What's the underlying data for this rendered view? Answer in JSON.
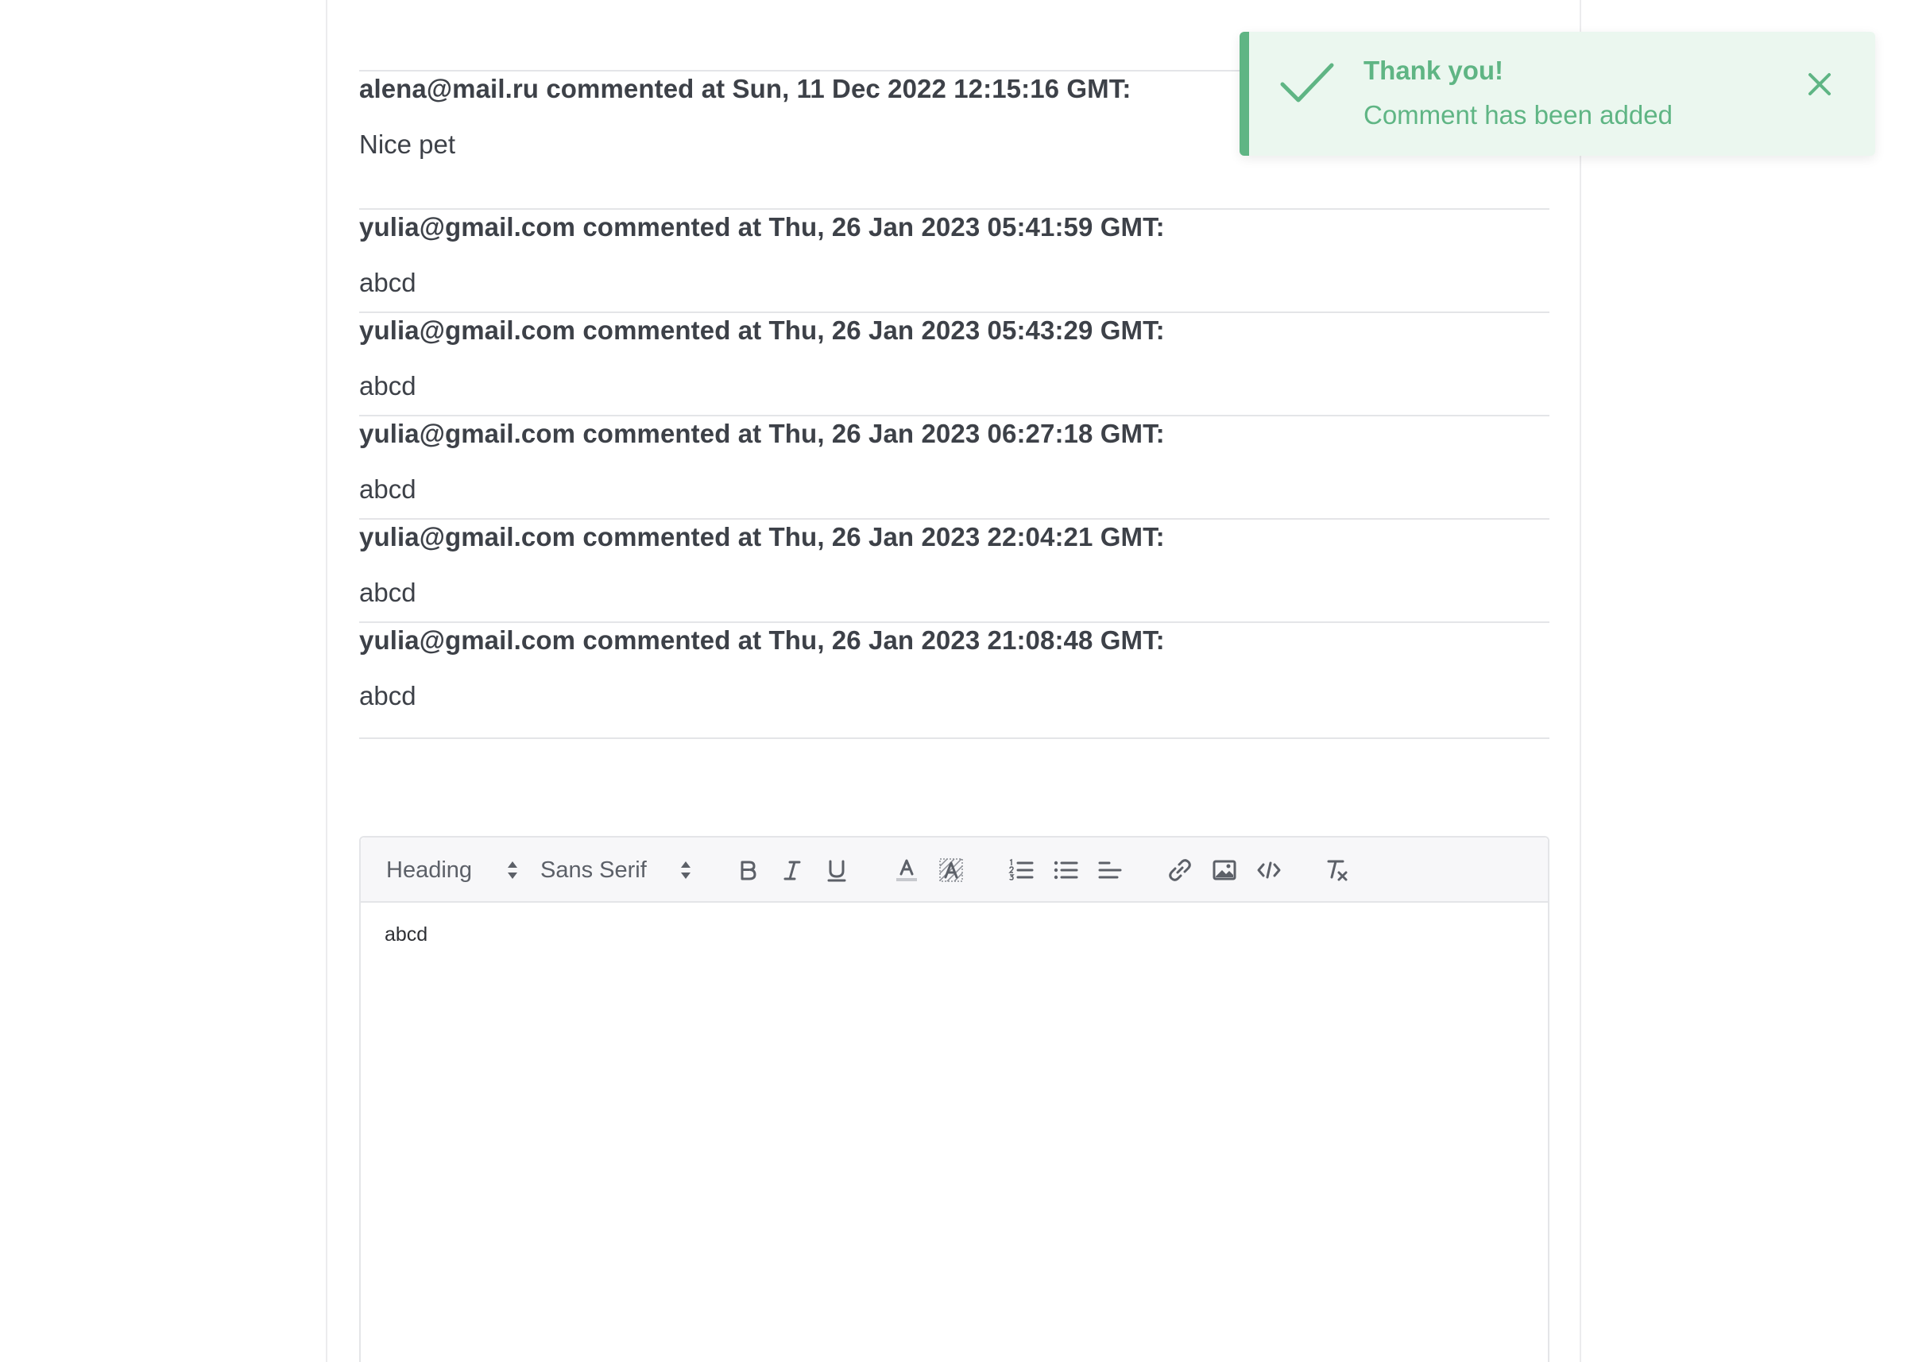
{
  "comments": [
    {
      "header": "alena@mail.ru commented at Sun, 11 Dec 2022 12:15:16 GMT:",
      "body": "Nice pet"
    },
    {
      "header": "yulia@gmail.com commented at Thu, 26 Jan 2023 05:41:59 GMT:",
      "body": "abcd"
    },
    {
      "header": "yulia@gmail.com commented at Thu, 26 Jan 2023 05:43:29 GMT:",
      "body": "abcd"
    },
    {
      "header": "yulia@gmail.com commented at Thu, 26 Jan 2023 06:27:18 GMT:",
      "body": "abcd"
    },
    {
      "header": "yulia@gmail.com commented at Thu, 26 Jan 2023 22:04:21 GMT:",
      "body": "abcd"
    },
    {
      "header": "yulia@gmail.com commented at Thu, 26 Jan 2023 21:08:48 GMT:",
      "body": "abcd"
    }
  ],
  "editor": {
    "heading_picker": "Heading",
    "font_picker": "Sans Serif",
    "content": "abcd",
    "tools": [
      "bold-icon",
      "italic-icon",
      "underline-icon",
      "text-color-icon",
      "background-color-icon",
      "ordered-list-icon",
      "bullet-list-icon",
      "align-icon",
      "link-icon",
      "image-icon",
      "code-icon",
      "clear-format-icon"
    ]
  },
  "toast": {
    "title": "Thank you!",
    "message": "Comment has been added",
    "accent": "#5fb584",
    "background": "#ebf7ef"
  }
}
